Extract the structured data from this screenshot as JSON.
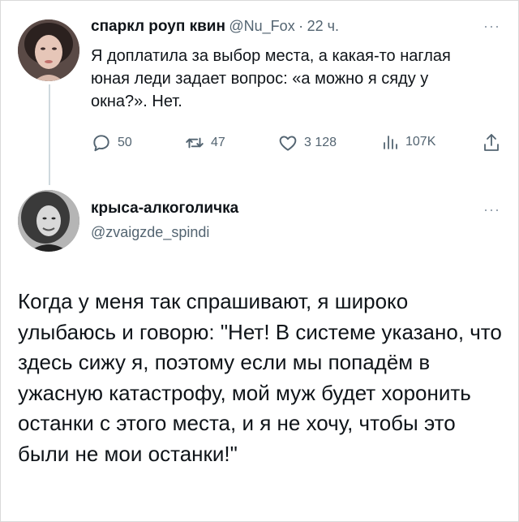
{
  "tweet1": {
    "display_name": "спаркл роуп квин",
    "handle": "@Nu_Fox",
    "separator": "·",
    "time": "22 ч.",
    "text": "Я доплатила за выбор места, а какая-то наглая юная леди задает вопрос: «а можно я сяду у окна?». Нет.",
    "actions": {
      "replies": "50",
      "retweets": "47",
      "likes": "3 128",
      "views": "107K"
    }
  },
  "tweet2": {
    "display_name": "крыса-алкоголичка",
    "handle": "@zvaigzde_spindi",
    "text": "Когда у меня так спрашивают, я широко улыбаюсь и говорю: \"Нет! В системе указано, что здесь сижу я, поэтому если мы попадём в ужасную катастрофу, мой муж будет хоронить останки с этого места, и я не хочу, чтобы это были не мои останки!\""
  },
  "icons": {
    "reply": "reply-icon",
    "retweet": "retweet-icon",
    "like": "like-icon",
    "views": "views-icon",
    "share": "share-icon",
    "more": "more-icon"
  },
  "colors": {
    "text": "#0f1419",
    "secondary": "#536471",
    "thread_line": "#cfd9de"
  }
}
